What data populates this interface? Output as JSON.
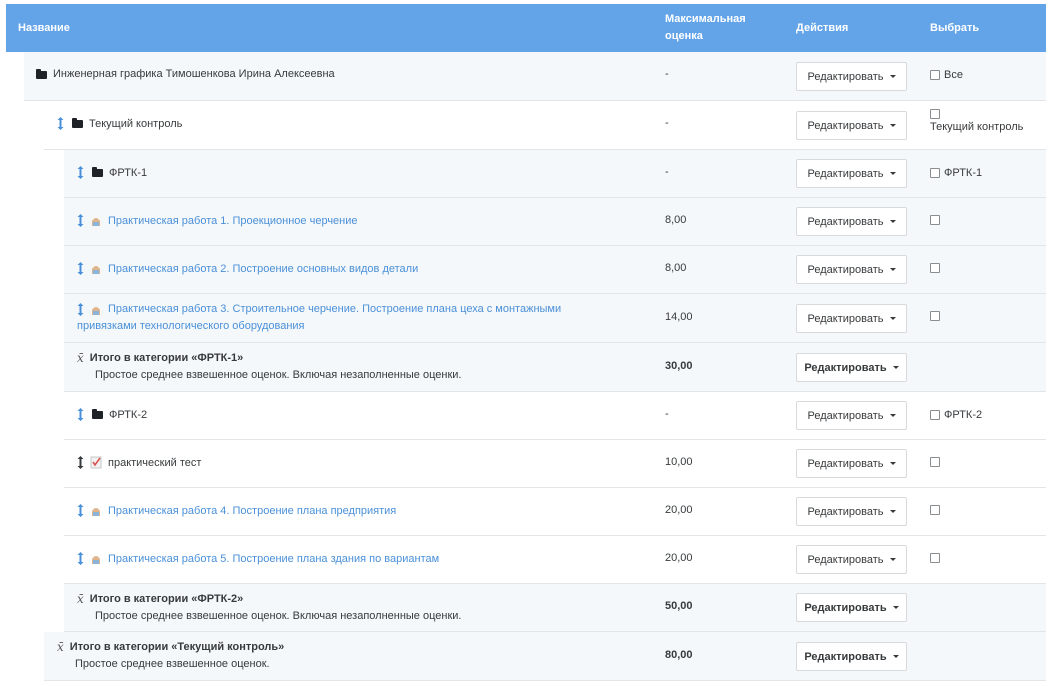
{
  "header": {
    "name": "Название",
    "max_grade": "Максимальная оценка",
    "actions": "Действия",
    "select": "Выбрать"
  },
  "edit_label": "Редактировать",
  "rows": [
    {
      "name": "Инженерная графика Тимошенкова Ирина Алексеевна",
      "max": "-",
      "select_label": "Все"
    },
    {
      "name": "Текущий контроль",
      "max": "-",
      "select_label": "Текущий контроль"
    },
    {
      "name": "ФРТК-1",
      "max": "-",
      "select_label": "ФРТК-1"
    },
    {
      "name": "Практическая работа 1. Проекционное черчение",
      "max": "8,00"
    },
    {
      "name": "Практическая работа 2. Построение основных видов детали",
      "max": "8,00"
    },
    {
      "name_line1": "Практическая работа 3. Строительное черчение. Построение плана цеха с монтажными",
      "name_line2": "привязками технологического оборудования",
      "max": "14,00"
    },
    {
      "title": "Итого в категории «ФРТК-1»",
      "subtitle": "Простое среднее взвешенное оценок. Включая незаполненные оценки.",
      "max": "30,00"
    },
    {
      "name": "ФРТК-2",
      "max": "-",
      "select_label": "ФРТК-2"
    },
    {
      "name": "практический тест",
      "max": "10,00"
    },
    {
      "name": "Практическая работа 4. Построение плана предприятия",
      "max": "20,00"
    },
    {
      "name": "Практическая работа 5. Построение плана здания по вариантам",
      "max": "20,00"
    },
    {
      "title": "Итого в категории «ФРТК-2»",
      "subtitle": "Простое среднее взвешенное оценок. Включая незаполненные оценки.",
      "max": "50,00"
    },
    {
      "title": "Итого в категории «Текущий контроль»",
      "subtitle": "Простое среднее взвешенное оценок.",
      "max": "80,00"
    }
  ],
  "icons": {
    "move": "move-icon",
    "folder": "folder-icon",
    "assignment": "assignment-icon",
    "quiz": "quiz-icon",
    "mean": "mean-icon"
  },
  "colors": {
    "header_bg": "#63a4e9",
    "link": "#4a90d9"
  }
}
